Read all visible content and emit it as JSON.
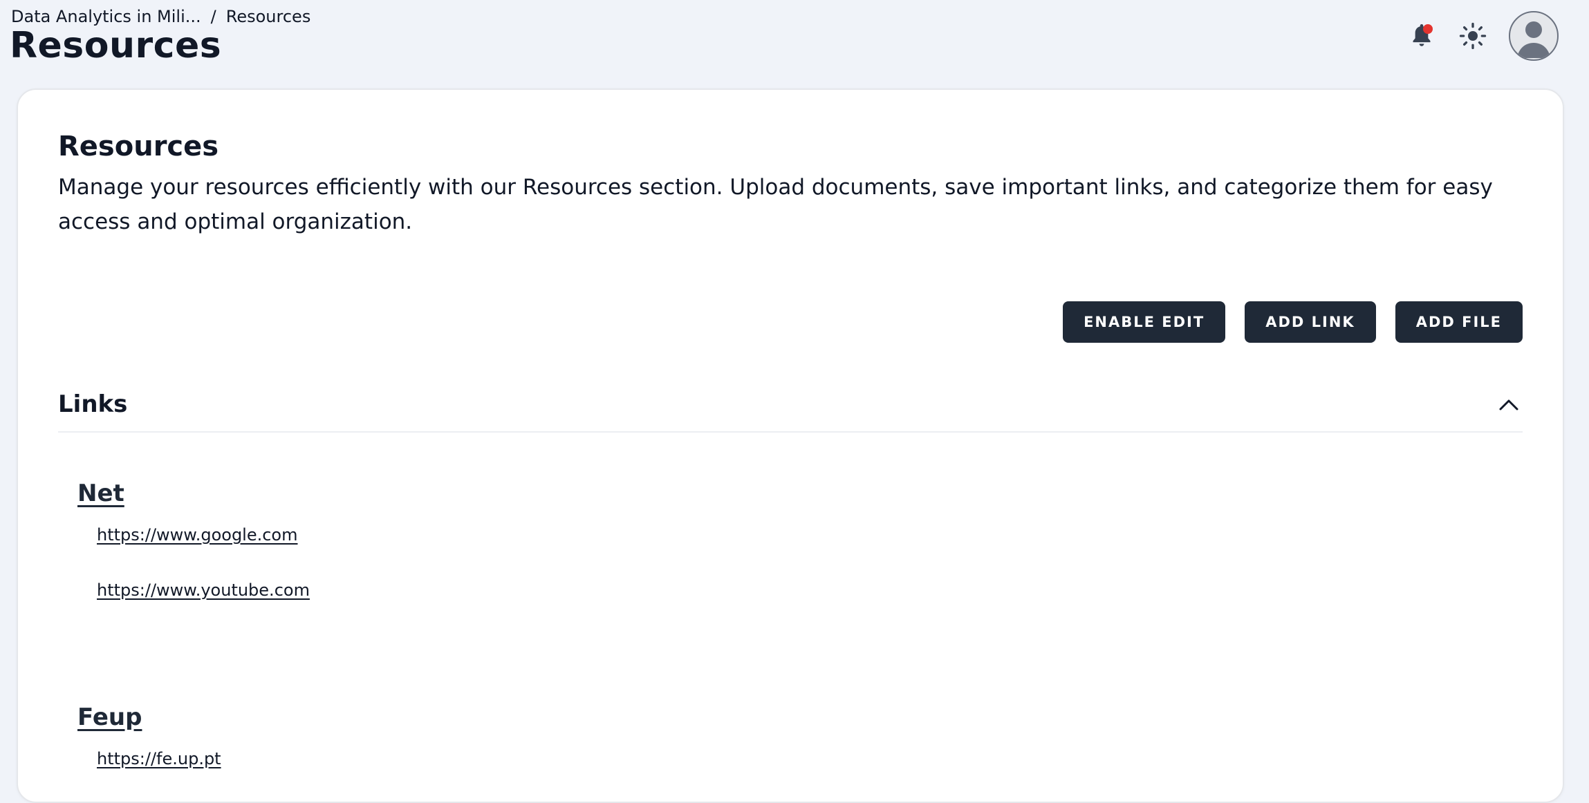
{
  "breadcrumb": {
    "parent": "Data Analytics in Mili...",
    "separator": "/",
    "current": "Resources"
  },
  "page": {
    "title": "Resources"
  },
  "header_icons": {
    "notifications": "bell-icon",
    "theme": "sun-icon",
    "avatar": "user-avatar-icon"
  },
  "card": {
    "title": "Resources",
    "description": "Manage your resources efficiently with our Resources section. Upload documents, save important links, and categorize them for easy access and optimal organization.",
    "buttons": {
      "enable_edit": "ENABLE EDIT",
      "add_link": "ADD LINK",
      "add_file": "ADD FILE"
    }
  },
  "links_section": {
    "title": "Links",
    "expanded": true,
    "groups": [
      {
        "name": "Net",
        "links": [
          "https://www.google.com",
          "https://www.youtube.com"
        ]
      },
      {
        "name": "Feup",
        "links": [
          "https://fe.up.pt"
        ]
      }
    ]
  },
  "colors": {
    "background": "#f0f3f9",
    "button": "#1f2937",
    "notification_dot": "#e3342f"
  }
}
